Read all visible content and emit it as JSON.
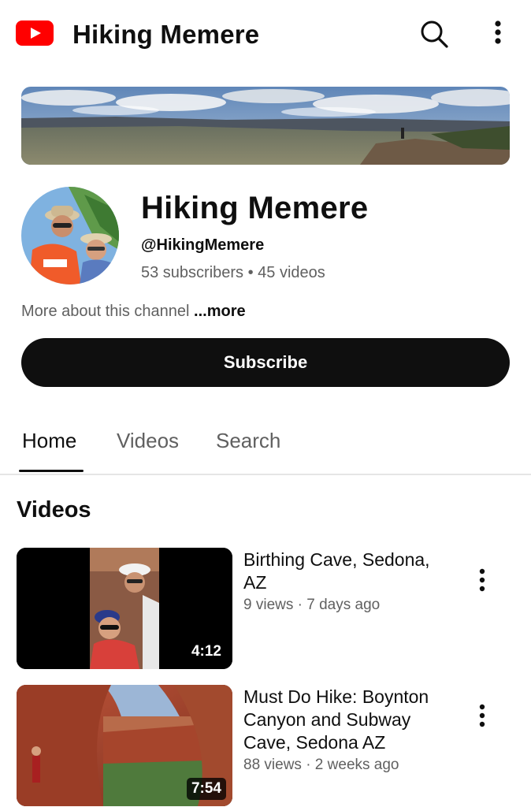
{
  "topbar": {
    "logo_icon": "youtube-logo-icon",
    "title": "Hiking Memere",
    "search_icon": "search-icon",
    "more_icon": "more-vert-icon"
  },
  "channel": {
    "name": "Hiking Memere",
    "handle": "@HikingMemere",
    "stats": "53 subscribers • 45 videos",
    "about": "More about this channel",
    "about_more": "...more",
    "subscribe_label": "Subscribe"
  },
  "tabs": [
    {
      "label": "Home",
      "active": true
    },
    {
      "label": "Videos",
      "active": false
    },
    {
      "label": "Search",
      "active": false
    }
  ],
  "section": {
    "title": "Videos"
  },
  "videos": [
    {
      "title": "Birthing Cave, Sedona, AZ",
      "meta": "9 views · 7 days ago",
      "duration": "4:12"
    },
    {
      "title": "Must Do Hike: Boynton Canyon and Subway Cave, Sedona AZ",
      "meta": "88 views · 2 weeks ago",
      "duration": "7:54"
    }
  ],
  "colors": {
    "brand_red": "#ff0000",
    "text_primary": "#0f0f0f",
    "text_secondary": "#606060",
    "subscribe_bg": "#0f0f0f"
  }
}
